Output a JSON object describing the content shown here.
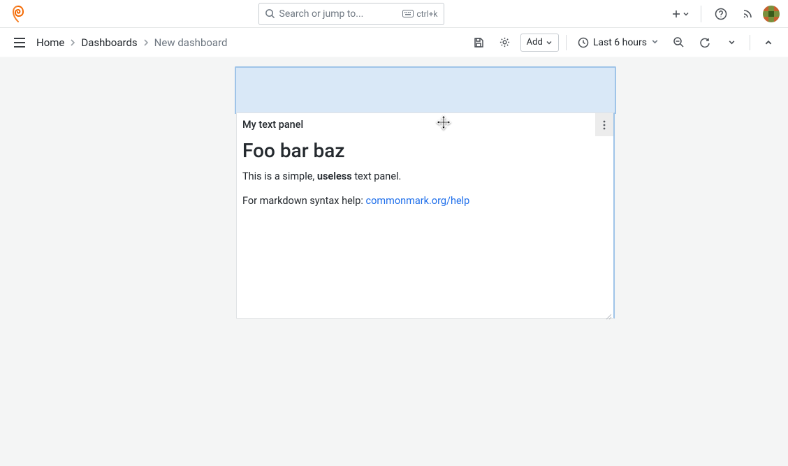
{
  "search": {
    "placeholder": "Search or jump to...",
    "shortcut": "ctrl+k"
  },
  "breadcrumb": {
    "home": "Home",
    "dashboards": "Dashboards",
    "current": "New dashboard"
  },
  "toolbar": {
    "add_label": "Add",
    "time_range": "Last 6 hours"
  },
  "panel": {
    "title": "My text panel",
    "heading": "Foo bar baz",
    "line1_prefix": "This is a simple, ",
    "line1_bold": "useless",
    "line1_suffix": " text panel.",
    "line2_prefix": "For markdown syntax help: ",
    "line2_link": "commonmark.org/help"
  }
}
